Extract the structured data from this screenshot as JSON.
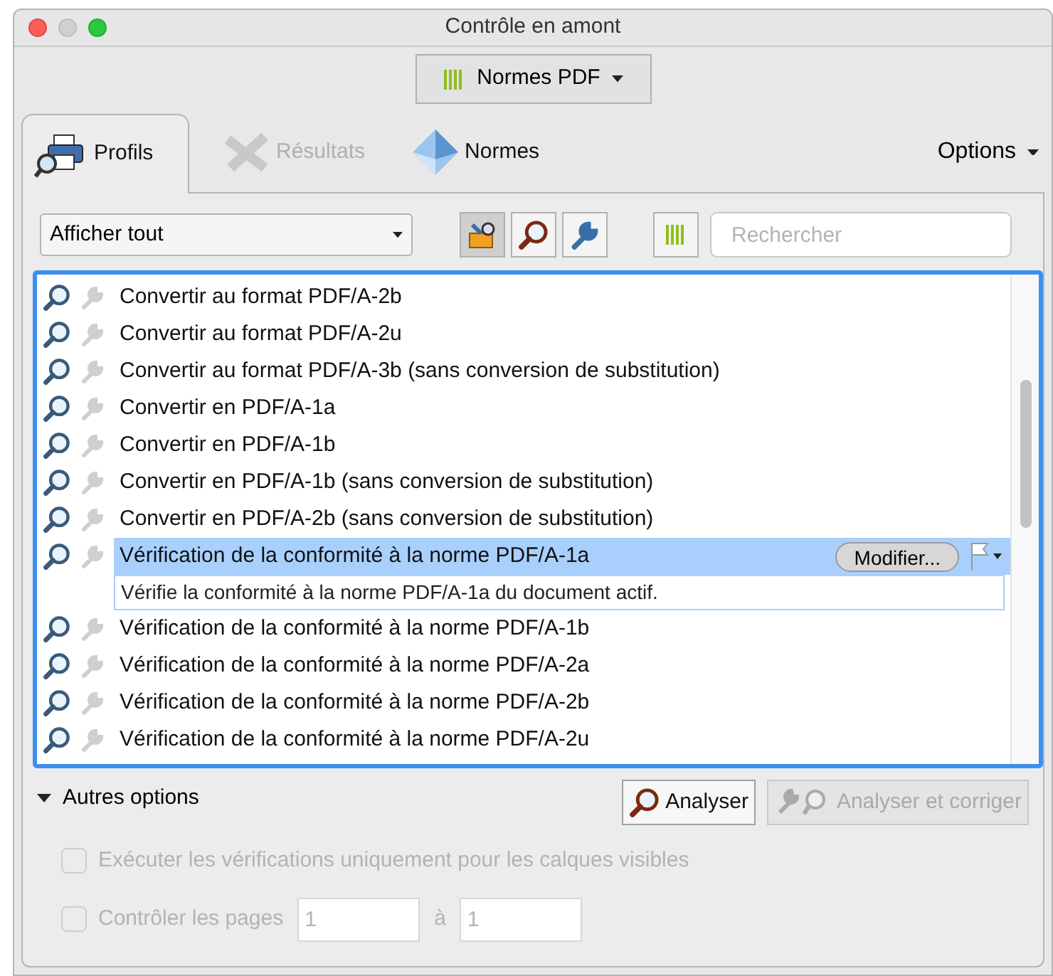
{
  "window": {
    "title": "Contrôle en amont"
  },
  "library_button": {
    "label": "Normes PDF"
  },
  "tabs": [
    {
      "label": "Profils",
      "selected": true,
      "disabled": false,
      "kind": "profiles"
    },
    {
      "label": "Résultats",
      "selected": false,
      "disabled": true,
      "kind": "results"
    },
    {
      "label": "Normes",
      "selected": false,
      "disabled": false,
      "kind": "standards"
    }
  ],
  "options_menu": {
    "label": "Options"
  },
  "filter": {
    "value": "Afficher tout"
  },
  "toolbar": [
    {
      "kind": "profiles",
      "selected": true
    },
    {
      "kind": "checks",
      "selected": false
    },
    {
      "kind": "fixups",
      "selected": false
    }
  ],
  "search": {
    "placeholder": "Rechercher"
  },
  "list": {
    "rows": [
      {
        "label": "Convertir au format PDF/A-2b",
        "selected": false
      },
      {
        "label": "Convertir au format PDF/A-2u",
        "selected": false
      },
      {
        "label": "Convertir au format PDF/A-3b (sans conversion de substitution)",
        "selected": false
      },
      {
        "label": "Convertir en PDF/A-1a",
        "selected": false
      },
      {
        "label": "Convertir en PDF/A-1b",
        "selected": false
      },
      {
        "label": "Convertir en PDF/A-1b (sans conversion de substitution)",
        "selected": false
      },
      {
        "label": "Convertir en PDF/A-2b (sans conversion de substitution)",
        "selected": false
      },
      {
        "label": "Vérification de la conformité à la norme PDF/A-1a",
        "selected": true,
        "action": "Modifier...",
        "description": "Vérifie la conformité à la norme PDF/A-1a du document actif."
      },
      {
        "label": "Vérification de la conformité à la norme PDF/A-1b",
        "selected": false
      },
      {
        "label": "Vérification de la conformité à la norme PDF/A-2a",
        "selected": false
      },
      {
        "label": "Vérification de la conformité à la norme PDF/A-2b",
        "selected": false
      },
      {
        "label": "Vérification de la conformité à la norme PDF/A-2u",
        "selected": false
      }
    ]
  },
  "more_options": {
    "label": "Autres options",
    "expanded": true
  },
  "analyze_button": {
    "label": "Analyser",
    "disabled": false
  },
  "analyze_fix_button": {
    "label": "Analyser et corriger",
    "disabled": true
  },
  "visible_layers": {
    "label": "Exécuter les vérifications uniquement pour les calques visibles",
    "checked": false,
    "disabled": true
  },
  "page_range": {
    "label": "Contrôler les pages",
    "checked": false,
    "disabled": true,
    "from": "1",
    "separator": "à",
    "to": "1"
  }
}
